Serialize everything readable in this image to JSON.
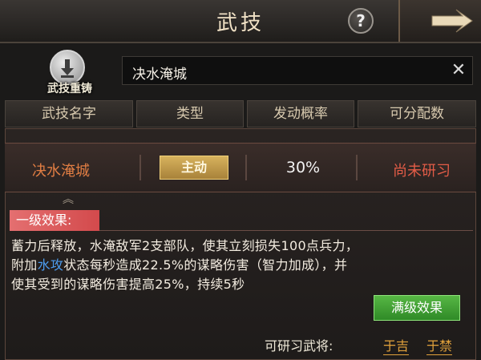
{
  "header": {
    "title": "武技"
  },
  "recast": {
    "label": "武技重铸"
  },
  "search": {
    "value": "决水淹城"
  },
  "columns": [
    "武技名字",
    "类型",
    "发动概率",
    "可分配数"
  ],
  "skill": {
    "name": "决水淹城",
    "type": "主动",
    "probability": "30%",
    "status": "尚未研习"
  },
  "effect": {
    "title": "一级效果:",
    "line1": "蓄力后释放，水淹敌军2支部队，使其立刻损失100点兵力，",
    "line2_prefix": "附加",
    "line2_keyword": "水攻",
    "line2_suffix": "状态每秒造成22.5%的谋略伤害（智力加成），并",
    "line3": "使其受到的谋略伤害提高25%，持续5秒"
  },
  "max_effect_button": "满级效果",
  "footer": {
    "label": "可研习武将:",
    "generals": [
      "于吉",
      "于禁"
    ]
  },
  "colors": {
    "skill_name": "#e07d43",
    "status": "#e35c47",
    "keyword": "#4d9df0",
    "green_button": "#3c9a30",
    "gold_badge": "#c79e4c"
  }
}
